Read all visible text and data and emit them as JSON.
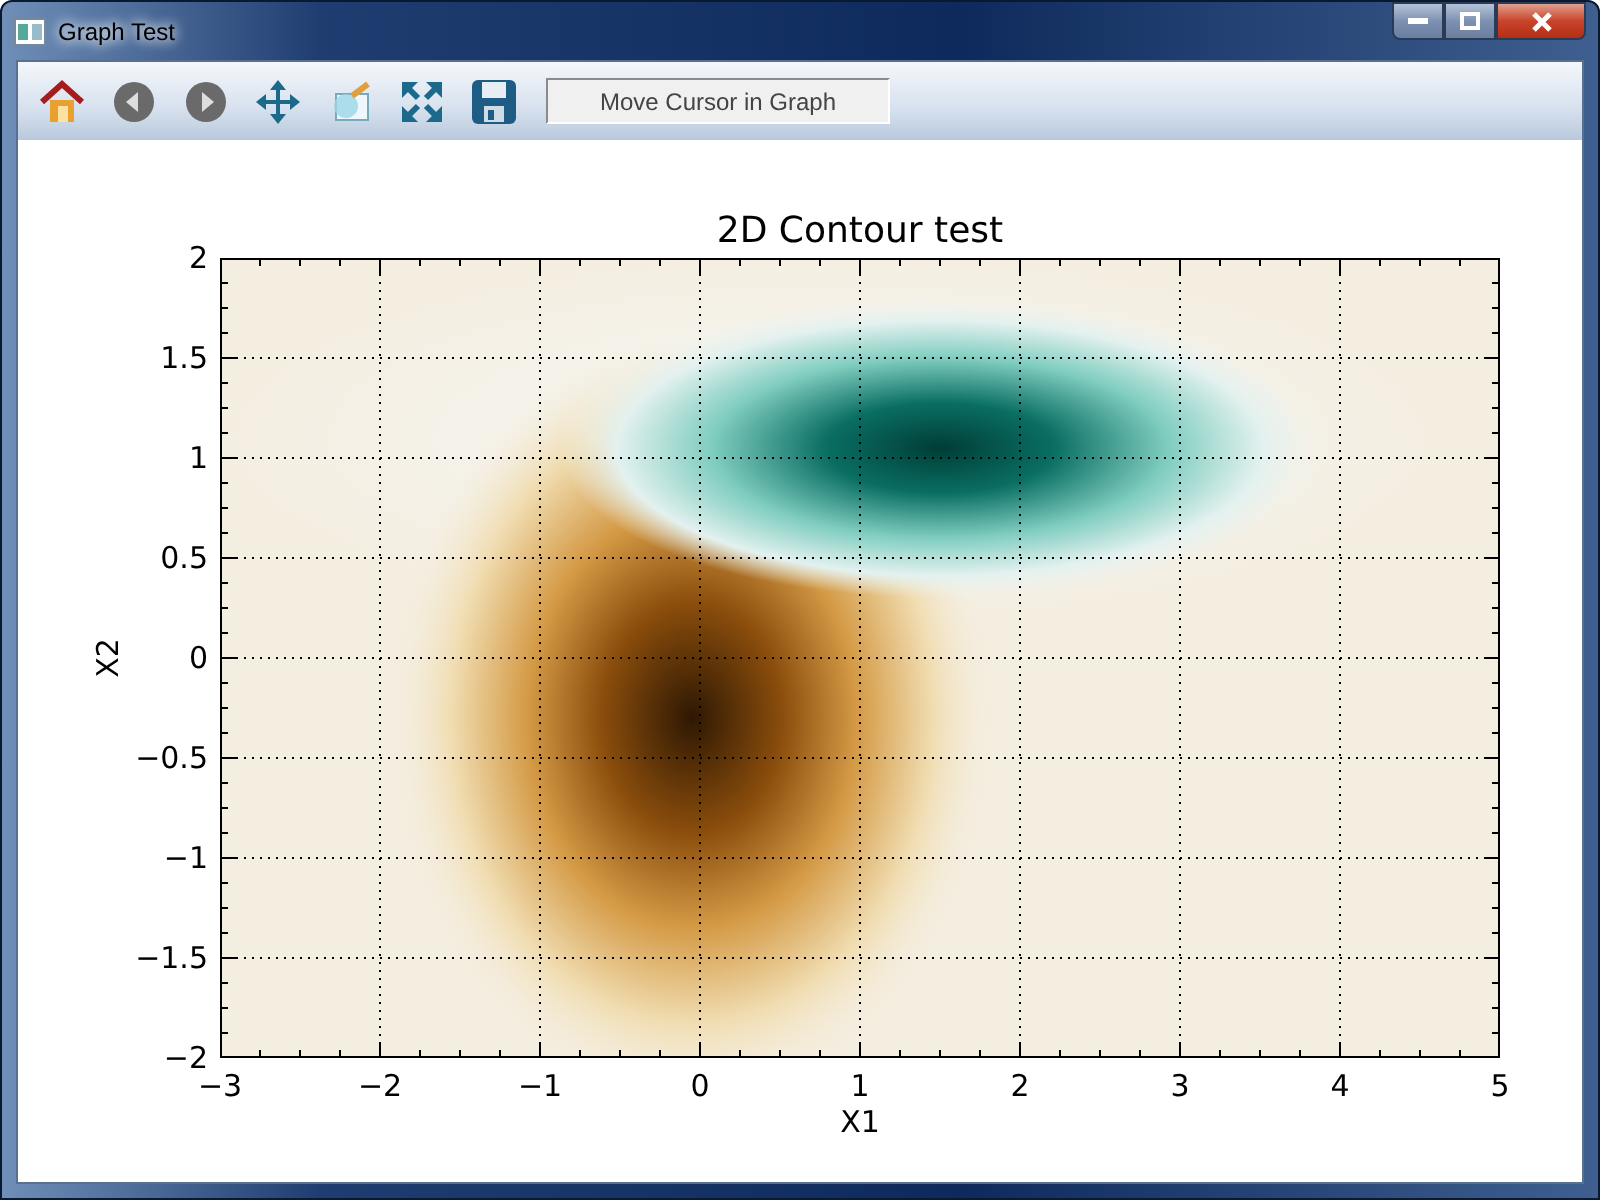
{
  "window": {
    "title": "Graph Test"
  },
  "status_field": {
    "value": "Move Cursor in Graph"
  },
  "plot": {
    "title": "2D Contour test",
    "xlabel": "X1",
    "ylabel": "X2",
    "xticks": [
      "−3",
      "−2",
      "−1",
      "0",
      "1",
      "2",
      "3",
      "4",
      "5"
    ],
    "yticks": [
      "2",
      "1.5",
      "1",
      "0.5",
      "0",
      "−0.5",
      "−1",
      "−1.5",
      "−2"
    ]
  }
}
